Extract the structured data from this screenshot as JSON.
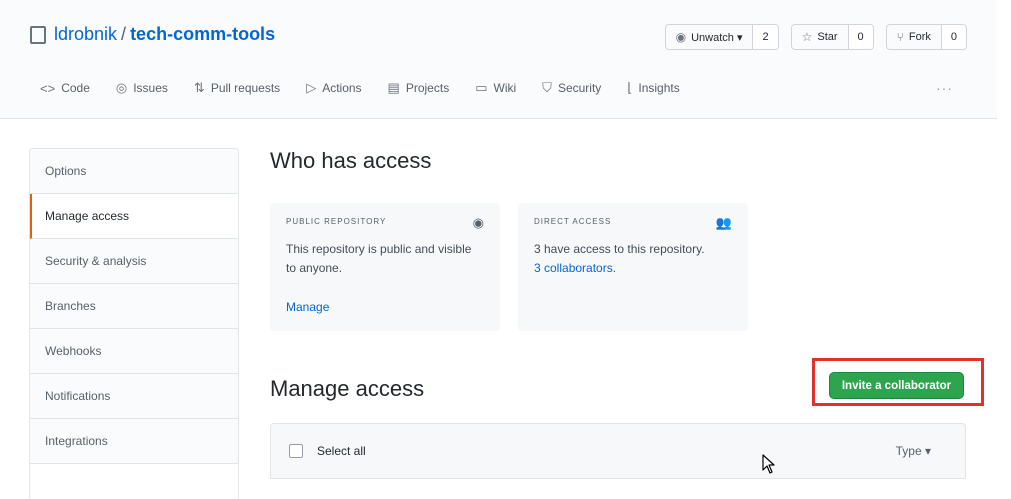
{
  "repo": {
    "owner": "ldrobnik",
    "separator": "/",
    "name": "tech-comm-tools"
  },
  "actions": [
    {
      "label": "Unwatch ▾",
      "icon": "eye-icon",
      "count": "2"
    },
    {
      "label": "Star",
      "icon": "star-icon",
      "count": "0"
    },
    {
      "label": "Fork",
      "icon": "fork-icon",
      "count": "0"
    }
  ],
  "tabs": [
    {
      "label": "Code",
      "icon": "code-icon"
    },
    {
      "label": "Issues",
      "icon": "issue-icon"
    },
    {
      "label": "Pull requests",
      "icon": "pull-request-icon"
    },
    {
      "label": "Actions",
      "icon": "play-icon"
    },
    {
      "label": "Projects",
      "icon": "project-icon"
    },
    {
      "label": "Wiki",
      "icon": "book-icon"
    },
    {
      "label": "Security",
      "icon": "shield-icon"
    },
    {
      "label": "Insights",
      "icon": "graph-icon"
    }
  ],
  "tabs_more": "···",
  "sidebar": {
    "items": [
      {
        "label": "Options"
      },
      {
        "label": "Manage access",
        "selected": true
      },
      {
        "label": "Security & analysis"
      },
      {
        "label": "Branches"
      },
      {
        "label": "Webhooks"
      },
      {
        "label": "Notifications"
      },
      {
        "label": "Integrations"
      }
    ]
  },
  "who_has_access": {
    "title": "Who has access",
    "public_card": {
      "label": "PUBLIC REPOSITORY",
      "icon": "eye-icon",
      "text": "This repository is public and visible to anyone.",
      "link": "Manage"
    },
    "direct_card": {
      "label": "DIRECT ACCESS",
      "icon": "people-icon",
      "text": "3 have access to this repository.",
      "link": "3 collaborators."
    }
  },
  "manage_access": {
    "title": "Manage access",
    "invite_button": "Invite a collaborator",
    "select_all": "Select all",
    "type_filter": "Type ▾"
  },
  "colors": {
    "accent_link": "#0366d6",
    "invite_green": "#2ea44f",
    "highlight_red": "#e0312b",
    "selected_marker": "#e36209"
  }
}
